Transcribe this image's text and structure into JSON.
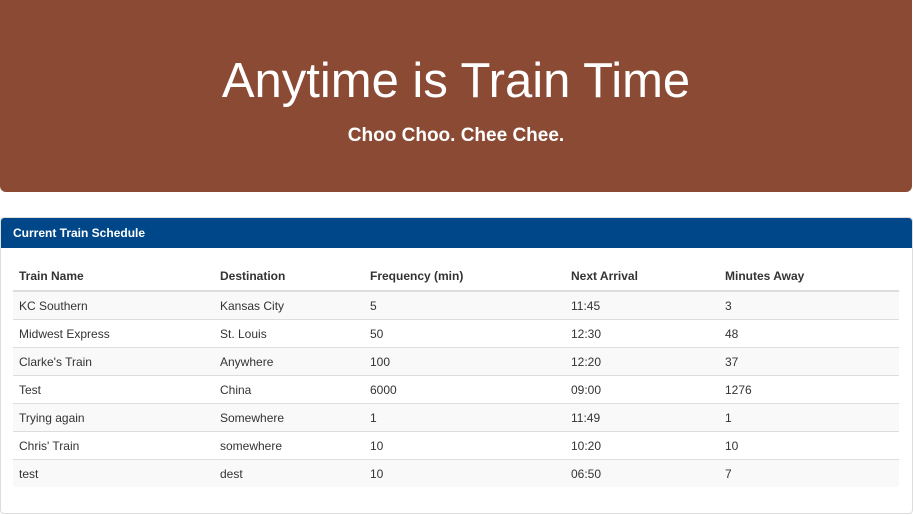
{
  "jumbotron": {
    "title": "Anytime is Train Time",
    "subtitle": "Choo Choo. Chee Chee."
  },
  "schedule": {
    "heading": "Current Train Schedule",
    "columns": [
      "Train Name",
      "Destination",
      "Frequency (min)",
      "Next Arrival",
      "Minutes Away"
    ],
    "rows": [
      [
        "KC Southern",
        "Kansas City",
        "5",
        "11:45",
        "3"
      ],
      [
        "Midwest Express",
        "St. Louis",
        "50",
        "12:30",
        "48"
      ],
      [
        "Clarke's Train",
        "Anywhere",
        "100",
        "12:20",
        "37"
      ],
      [
        "Test",
        "China",
        "6000",
        "09:00",
        "1276"
      ],
      [
        "Trying again",
        "Somewhere",
        "1",
        "11:49",
        "1"
      ],
      [
        "Chris' Train",
        "somewhere",
        "10",
        "10:20",
        "10"
      ],
      [
        "test",
        "dest",
        "10",
        "06:50",
        "7"
      ]
    ]
  },
  "colors": {
    "jumbotron_bg": "#8b4a34",
    "panel_heading_bg": "#00478a"
  }
}
